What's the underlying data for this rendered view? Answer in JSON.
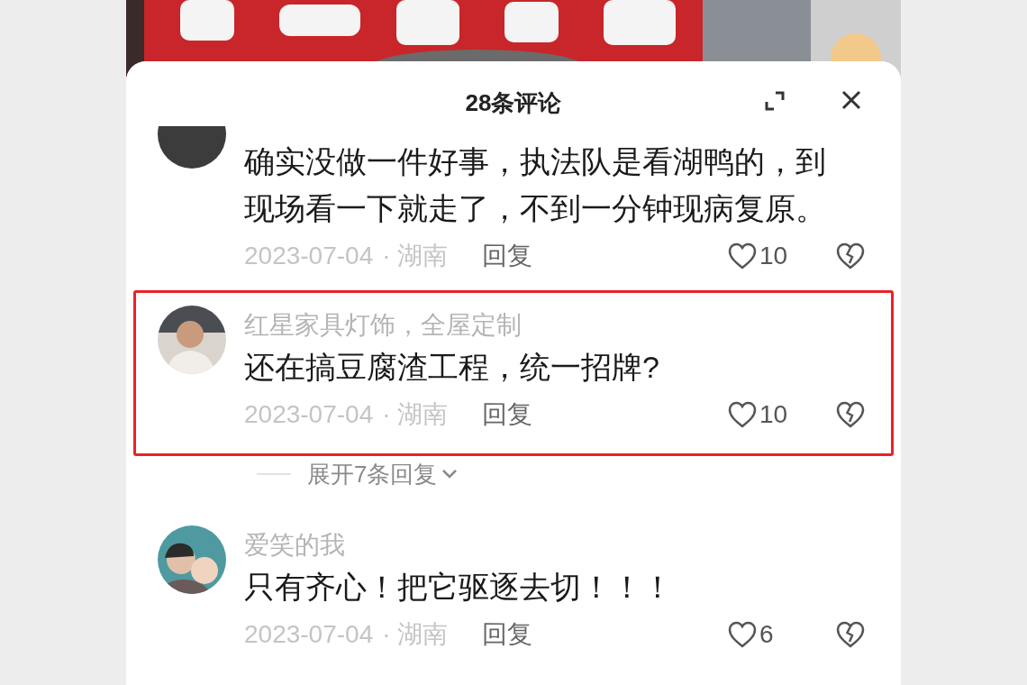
{
  "panel": {
    "title": "28条评论"
  },
  "comments": [
    {
      "text": "确实没做一件好事，执法队是看湖鸭的，到现场看一下就走了，不到一分钟现病复原。",
      "date": "2023-07-04",
      "region": "· 湖南",
      "reply": "回复",
      "likes": "10",
      "highlighted": false
    },
    {
      "author": "红星家具灯饰，全屋定制",
      "text": "还在搞豆腐渣工程，统一招牌?",
      "date": "2023-07-04",
      "region": "· 湖南",
      "reply": "回复",
      "likes": "10",
      "highlighted": true,
      "replies_toggle": "展开7条回复"
    },
    {
      "author": "爱笑的我",
      "text": "只有齐心！把它驱逐去切！！！",
      "date": "2023-07-04",
      "region": "· 湖南",
      "reply": "回复",
      "likes": "6",
      "highlighted": false
    }
  ]
}
